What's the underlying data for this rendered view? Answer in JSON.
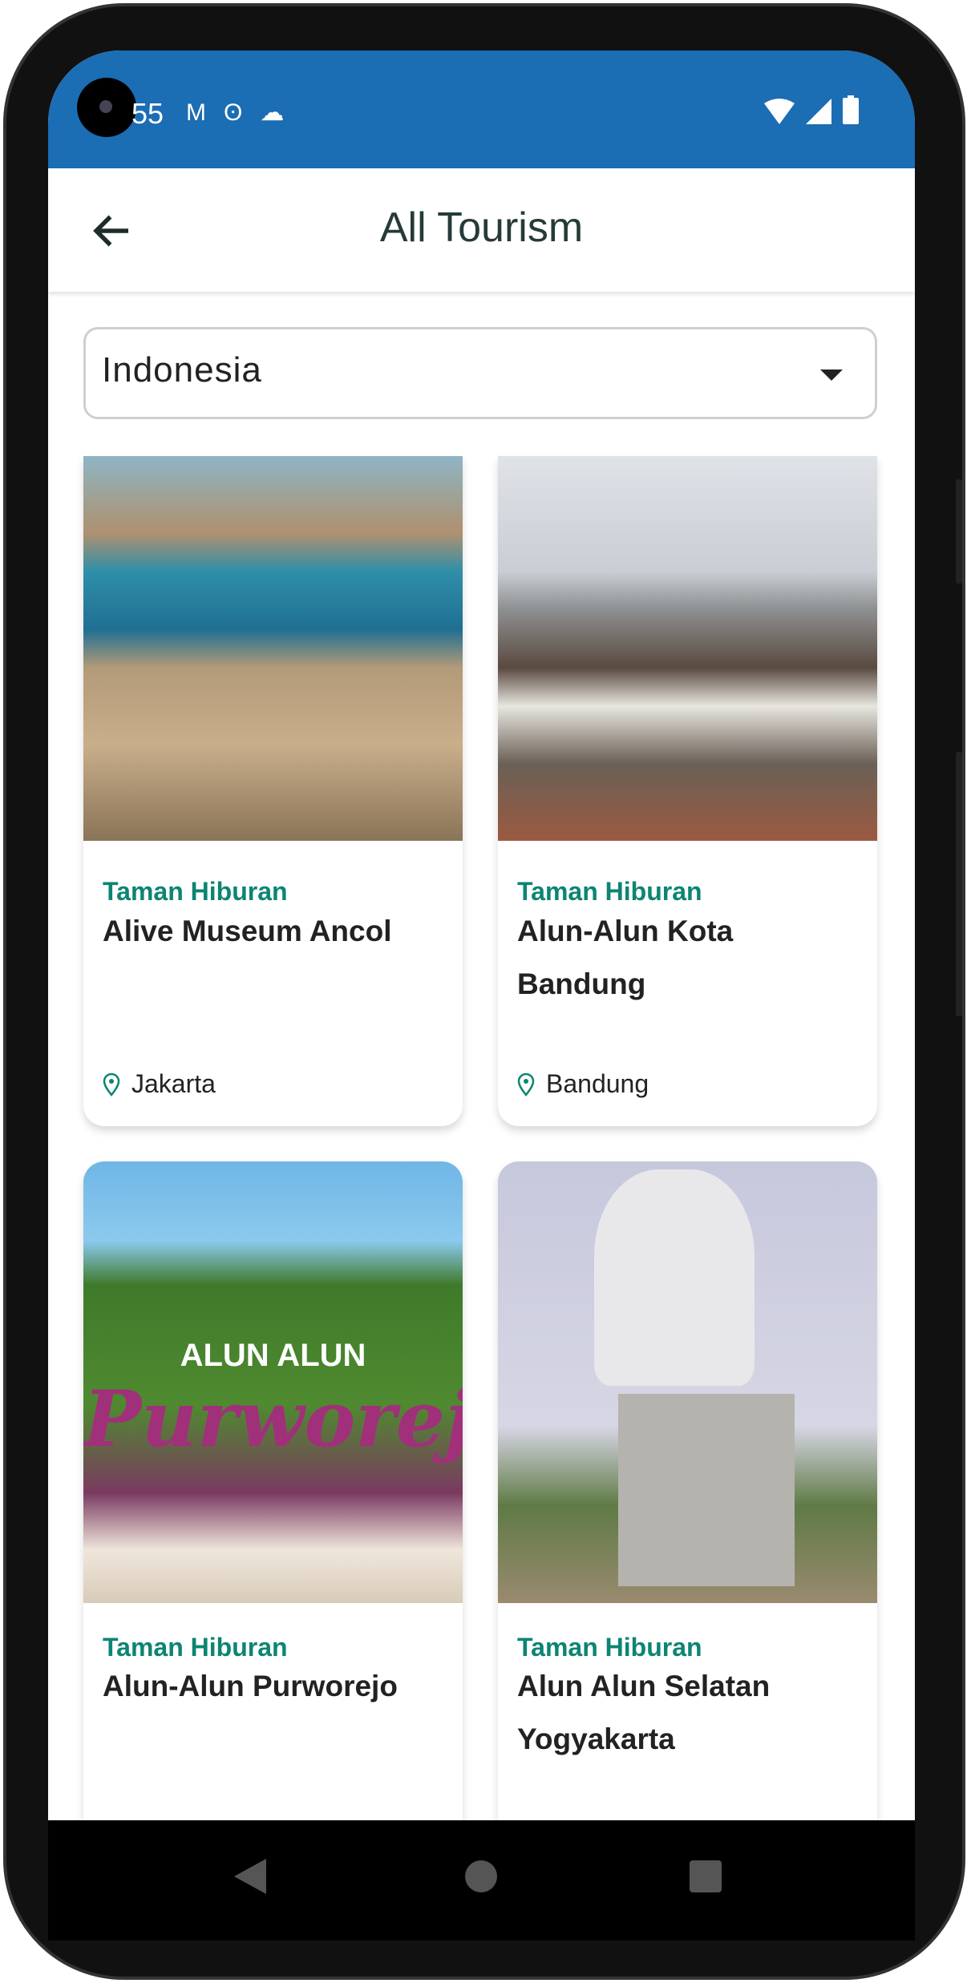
{
  "status_bar": {
    "time": "55",
    "left_icons": [
      "gmail-icon",
      "app-icon",
      "cloud-icon"
    ],
    "right_icons": [
      "wifi-icon",
      "signal-icon",
      "battery-icon"
    ]
  },
  "header": {
    "title": "All Tourism"
  },
  "filter": {
    "selected": "Indonesia"
  },
  "cards": [
    {
      "category": "Taman Hiburan",
      "name": "Alive Museum Ancol",
      "location": "Jakarta"
    },
    {
      "category": "Taman Hiburan",
      "name": "Alun-Alun Kota Bandung",
      "location": "Bandung"
    },
    {
      "category": "Taman Hiburan",
      "name": "Alun-Alun Purworejo"
    },
    {
      "category": "Taman Hiburan",
      "name": "Alun Alun Selatan Yogyakarta"
    }
  ],
  "image_text": {
    "purworejo_sign_top": "ALUN ALUN",
    "purworejo_sign": "Purworejo"
  },
  "colors": {
    "status_bar": "#1b6db4",
    "accent": "#0c8572"
  }
}
